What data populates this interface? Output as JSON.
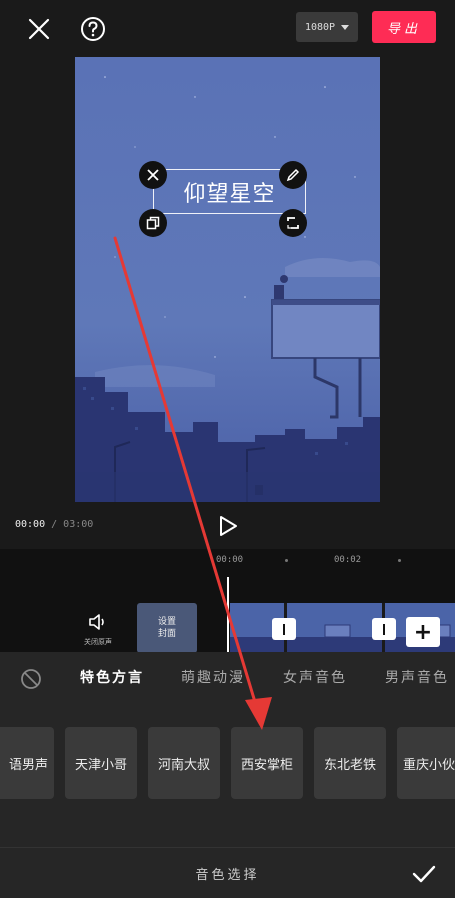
{
  "topbar": {
    "resolution_label": "1080P",
    "export_label": "导出"
  },
  "preview": {
    "title_text": "仰望星空"
  },
  "player": {
    "current_time": "00:00",
    "separator": " / ",
    "duration": "03:00"
  },
  "timeline": {
    "ruler": [
      "00:00",
      "00:02"
    ],
    "mute_label": "关闭原声",
    "cover_label_line1": "设置",
    "cover_label_line2": "封面"
  },
  "voice_panel": {
    "tabs": [
      {
        "label": "特色方言",
        "active": true
      },
      {
        "label": "萌趣动漫",
        "active": false
      },
      {
        "label": "女声音色",
        "active": false
      },
      {
        "label": "男声音色",
        "active": false
      }
    ],
    "voices": [
      "语男声",
      "天津小哥",
      "河南大叔",
      "西安掌柜",
      "东北老铁",
      "重庆小伙"
    ],
    "footer_title": "音色选择"
  },
  "annotation": {
    "arrow_color": "#e53935"
  }
}
